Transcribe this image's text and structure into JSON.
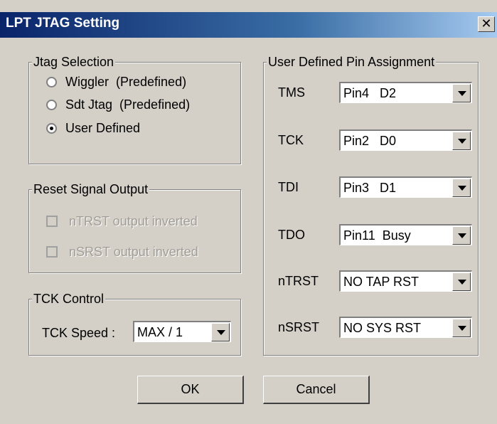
{
  "window": {
    "title": "LPT JTAG Setting",
    "close_label": "✕"
  },
  "jtag_selection": {
    "legend": "Jtag Selection",
    "options": [
      {
        "label": "Wiggler  (Predefined)",
        "selected": false
      },
      {
        "label": "Sdt Jtag  (Predefined)",
        "selected": false
      },
      {
        "label": "User Defined",
        "selected": true
      }
    ]
  },
  "reset_signal": {
    "legend": "Reset Signal Output",
    "options": [
      {
        "label": "nTRST output inverted",
        "checked": false,
        "enabled": false
      },
      {
        "label": "nSRST output inverted",
        "checked": false,
        "enabled": false
      }
    ]
  },
  "tck_control": {
    "legend": "TCK Control",
    "speed_label": "TCK Speed :",
    "speed_value": "MAX / 1"
  },
  "pin_assignment": {
    "legend": "User Defined Pin Assignment",
    "rows": [
      {
        "label": "TMS",
        "value": "Pin4   D2"
      },
      {
        "label": "TCK",
        "value": "Pin2   D0"
      },
      {
        "label": "TDI",
        "value": "Pin3   D1"
      },
      {
        "label": "TDO",
        "value": "Pin11  Busy"
      },
      {
        "label": "nTRST",
        "value": "NO TAP RST"
      },
      {
        "label": "nSRST",
        "value": "NO SYS RST"
      }
    ]
  },
  "buttons": {
    "ok": "OK",
    "cancel": "Cancel"
  }
}
